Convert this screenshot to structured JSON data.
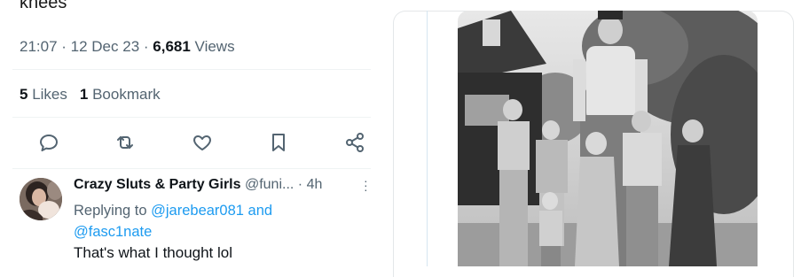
{
  "tweet": {
    "clipped_text": "knees",
    "timestamp": "21:07 · 12 Dec 23 · ",
    "views_count": "6,681",
    "views_label": " Views",
    "likes_count": "5",
    "likes_label": " Likes",
    "bookmarks_count": "1",
    "bookmarks_label": " Bookmark"
  },
  "actions": [
    {
      "icon": "reply-icon"
    },
    {
      "icon": "retweet-icon"
    },
    {
      "icon": "like-icon"
    },
    {
      "icon": "bookmark-icon"
    },
    {
      "icon": "share-icon"
    }
  ],
  "reply": {
    "name": "Crazy Sluts & Party Girls",
    "handle": " @funi...",
    "time": " · 4h",
    "replying_prefix": "Replying to ",
    "mention1": "@jarebear081",
    "and_word": " and",
    "mention2": "@fasc1nate",
    "text": "That's what I thought lol"
  },
  "colors": {
    "secondary_text": "#536471",
    "primary_text": "#0f1419",
    "link": "#1d9bf0"
  }
}
